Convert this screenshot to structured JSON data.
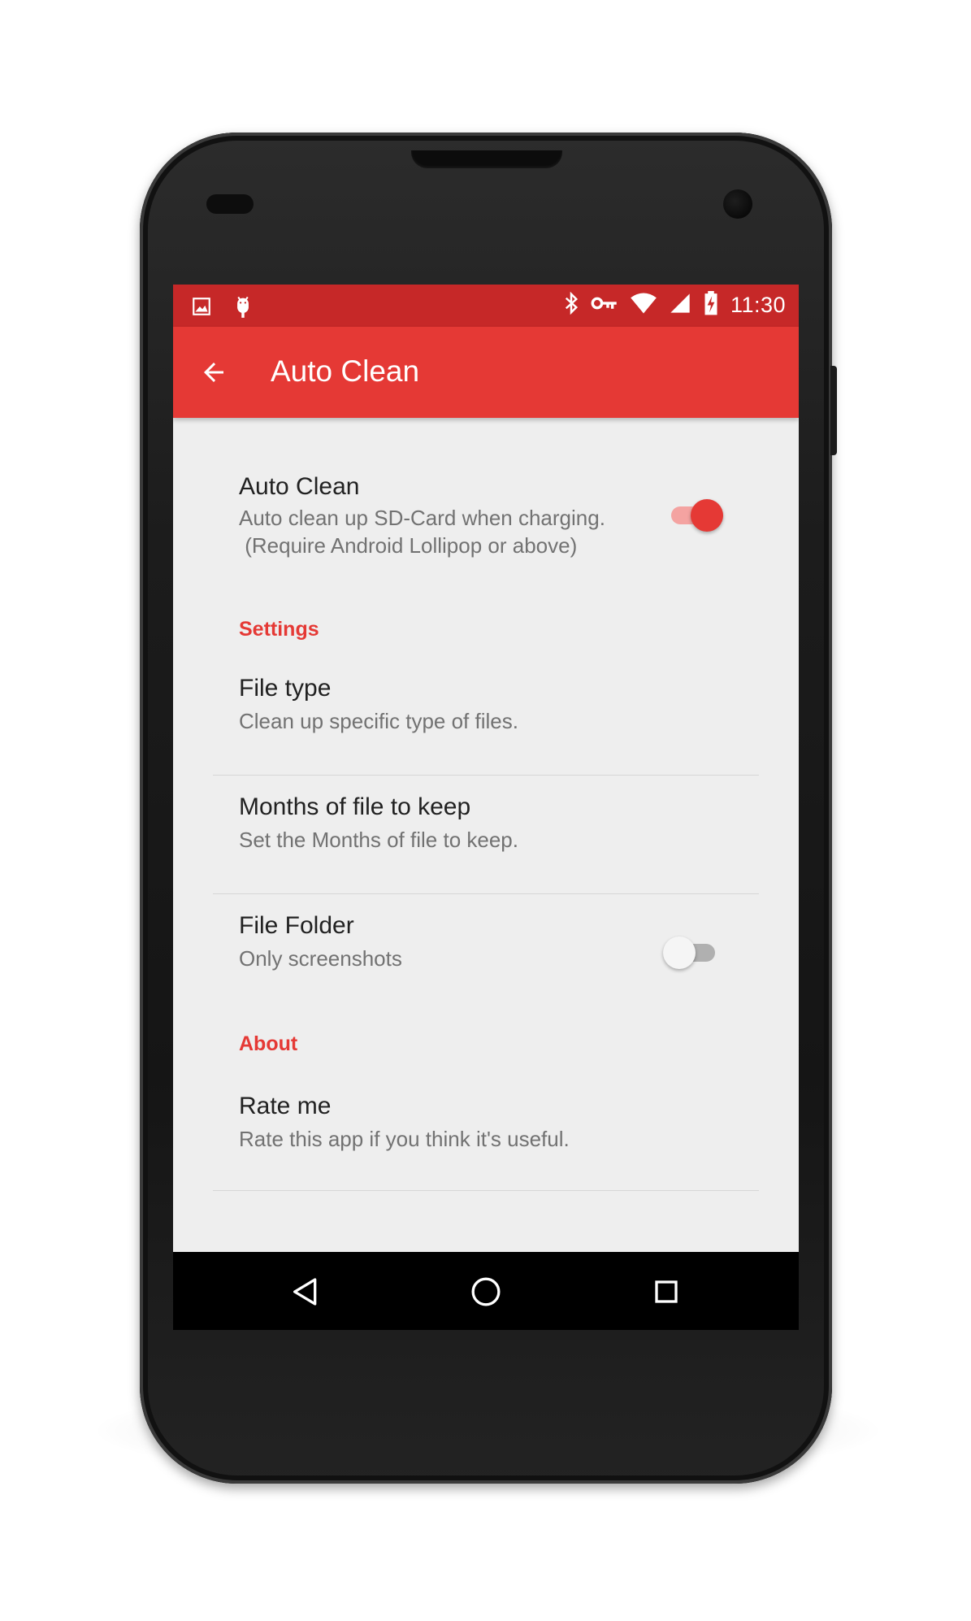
{
  "status_bar": {
    "time": "11:30",
    "left_icons": [
      "image-icon",
      "android-debug-icon"
    ],
    "right_icons": [
      "bluetooth-icon",
      "vpn-key-icon",
      "wifi-icon",
      "cell-signal-icon",
      "battery-charging-icon"
    ]
  },
  "toolbar": {
    "title": "Auto Clean",
    "back_icon": "arrow-back-icon"
  },
  "prefs": {
    "auto_clean": {
      "title": "Auto Clean",
      "summary": "Auto clean up SD-Card when charging.\n (Require Android Lollipop or above)",
      "enabled": true
    },
    "settings_header": "Settings",
    "file_type": {
      "title": "File type",
      "summary": "Clean up specific type of files."
    },
    "months_to_keep": {
      "title": "Months of file to keep",
      "summary": "Set the Months of file to keep."
    },
    "file_folder": {
      "title": "File Folder",
      "summary": "Only screenshots",
      "enabled": false
    },
    "about_header": "About",
    "rate_me": {
      "title": "Rate me",
      "summary": "Rate this app if you think it's useful."
    }
  },
  "nav_bar": {
    "icons": [
      "back-triangle-icon",
      "home-circle-icon",
      "recents-square-icon"
    ]
  },
  "colors": {
    "status_bar": "#c62828",
    "primary": "#e53935",
    "background": "#eeeeee",
    "switch_track_on": "#f4a3a1",
    "switch_track_off": "#b0b0b0"
  }
}
